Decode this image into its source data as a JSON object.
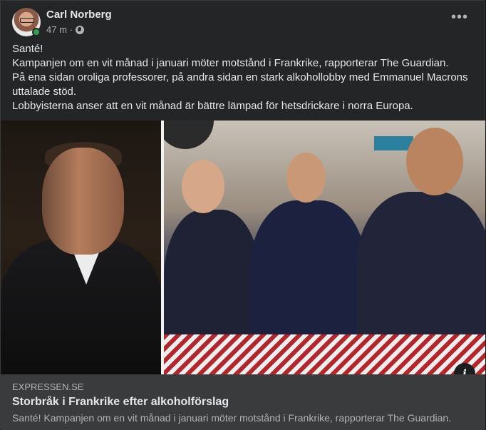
{
  "post": {
    "author": "Carl Norberg",
    "time": "47 m",
    "separator": "·",
    "more_label": "•••",
    "text_lines": [
      "Santé!",
      "Kampanjen om en vit månad i januari möter motstånd i Frankrike, rapporterar The Guardian.",
      "På ena sidan oroliga professorer, på andra sidan en stark alkohollobby med Emmanuel Macrons",
      "uttalade stöd.",
      "Lobbyisterna anser att en vit månad är bättre lämpad för hetsdrickare i norra Europa."
    ]
  },
  "link": {
    "domain": "EXPRESSEN.SE",
    "title": "Storbråk i Frankrike efter alkoholförslag",
    "description": "Santé! Kampanjen om en vit månad i januari möter motstånd i Frankrike, rapporterar The Guardian.",
    "info_label": "i"
  },
  "colors": {
    "card_bg": "#242526",
    "link_bg": "#3a3b3c",
    "text_primary": "#e4e6eb",
    "text_secondary": "#b0b3b8",
    "online": "#31a24c"
  },
  "icons": [
    "globe-icon",
    "more-options-icon",
    "info-icon"
  ]
}
